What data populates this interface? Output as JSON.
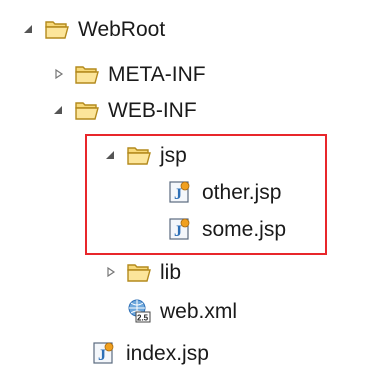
{
  "tree": {
    "nodes": [
      {
        "label": "WebRoot",
        "expanded": true,
        "kind": "folder-open",
        "depth": 0
      },
      {
        "label": "META-INF",
        "expanded": false,
        "kind": "folder-closed",
        "depth": 1
      },
      {
        "label": "WEB-INF",
        "expanded": true,
        "kind": "folder-open",
        "depth": 1
      },
      {
        "label": "jsp",
        "expanded": true,
        "kind": "folder-open",
        "depth": 2
      },
      {
        "label": "other.jsp",
        "kind": "jsp-file",
        "depth": 3
      },
      {
        "label": "some.jsp",
        "kind": "jsp-file",
        "depth": 3
      },
      {
        "label": "lib",
        "expanded": false,
        "kind": "folder-closed",
        "depth": 2
      },
      {
        "label": "web.xml",
        "kind": "web-xml-file",
        "depth": 2
      },
      {
        "label": "index.jsp",
        "kind": "jsp-file",
        "depth": 1
      }
    ]
  },
  "icons": {
    "expanded": "expanded-triangle-icon",
    "collapsed": "collapsed-triangle-icon",
    "folder": "folder-icon",
    "jsp": "jsp-file-icon",
    "xml": "web-xml-icon"
  },
  "colors": {
    "highlight": "#e8262b",
    "folder_stroke": "#b38a1d",
    "folder_fill": "#f8d979",
    "jsp_blue": "#2d6fb6"
  }
}
